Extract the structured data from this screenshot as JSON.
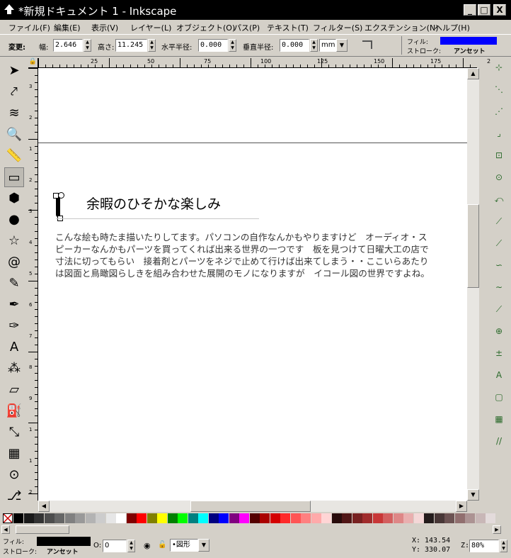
{
  "window": {
    "title": "*新規ドキュメント 1 - Inkscape",
    "buttons": [
      "_",
      "□",
      "X"
    ]
  },
  "menu": {
    "items": [
      "ファイル(F)",
      "編集(E)",
      "表示(V)",
      "レイヤー(L)",
      "オブジェクト(O)",
      "パス(P)",
      "テキスト(T)",
      "フィルター(S)",
      "エクステンション(N)",
      "ヘルプ(H)"
    ]
  },
  "controls": {
    "change_label": "変更:",
    "width_label": "幅:",
    "width_value": "2.646",
    "height_label": "高さ:",
    "height_value": "11.245",
    "rx_label": "水平半径:",
    "rx_value": "0.000",
    "ry_label": "垂直半径:",
    "ry_value": "0.000",
    "unit": "mm",
    "fill_label": "フィル:",
    "stroke_label": "ストローク:",
    "stroke_value": "アンセット",
    "fill_color": "#0000ff"
  },
  "ruler": {
    "h_ticks": [
      "25",
      "50",
      "75",
      "100",
      "125",
      "150",
      "175",
      "2"
    ],
    "v_ticks": [
      "3",
      "2",
      "1",
      "2",
      "3",
      "4",
      "5",
      "6",
      "7",
      "8",
      "9",
      "1",
      "1",
      "2"
    ]
  },
  "document": {
    "heading": "余暇のひそかな楽しみ",
    "body_lines": [
      "こんな絵も時たま描いたりしてます。パソコンの自作なんかもやりますけど　オーディオ・ス",
      "ピーカーなんかもパーツを買ってくれば出来る世界の一つです　板を見つけて日曜大工の店で",
      "寸法に切ってもらい　接着剤とパーツをネジで止めて行けば出来てしまう・・ここいらあたり",
      "は図面と鳥瞰図らしきを組み合わせた展開のモノになりますが　イコール図の世界ですよね。"
    ]
  },
  "palette": {
    "colors": [
      "#000000",
      "#1a1a1a",
      "#333333",
      "#4d4d4d",
      "#666666",
      "#808080",
      "#999999",
      "#b3b3b3",
      "#cccccc",
      "#e6e6e6",
      "#ffffff",
      "#800000",
      "#ff0000",
      "#808000",
      "#ffff00",
      "#008000",
      "#00ff00",
      "#008080",
      "#00ffff",
      "#000080",
      "#0000ff",
      "#800080",
      "#ff00ff",
      "#550000",
      "#aa0000",
      "#d40000",
      "#ff2a2a",
      "#ff5555",
      "#ff8080",
      "#ffaaaa",
      "#ffd5d5",
      "#280b0b",
      "#501616",
      "#782121",
      "#a02c2c",
      "#c83737",
      "#d35f5f",
      "#de8787",
      "#e9afaf",
      "#f4d7d7",
      "#241c1c",
      "#483737",
      "#6c5353",
      "#916f6f",
      "#ac9393",
      "#c8b7b7",
      "#e3dbdb"
    ]
  },
  "status": {
    "fill_label": "フィル:",
    "stroke_label": "ストローク:",
    "stroke_value": "アンセット",
    "opacity_label": "O:",
    "opacity_value": "0",
    "layer": "•図形",
    "x_label": "X:",
    "x_value": "143.54",
    "y_label": "Y:",
    "y_value": "330.07",
    "zoom_label": "Z:",
    "zoom_value": "80%"
  },
  "icons": {
    "tools": [
      "selector-icon",
      "node-icon",
      "tweak-icon",
      "zoom-icon",
      "measure-icon",
      "rect-icon",
      "3dbox-icon",
      "ellipse-icon",
      "star-icon",
      "spiral-icon",
      "pencil-icon",
      "pen-icon",
      "calligraphy-icon",
      "text-icon",
      "spray-icon",
      "eraser-icon",
      "bucket-icon",
      "gradient-icon",
      "mesh-icon",
      "dropper-icon",
      "connector-icon"
    ]
  }
}
